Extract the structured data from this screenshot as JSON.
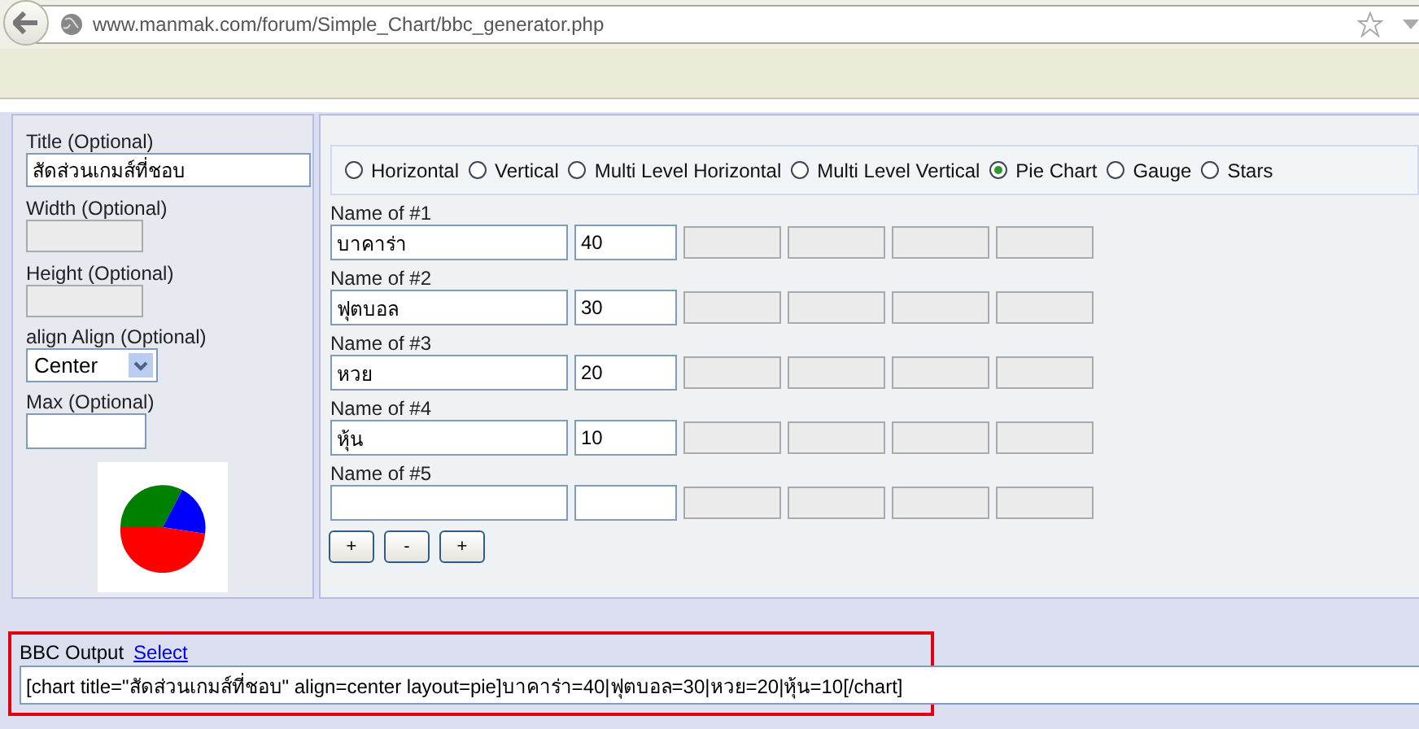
{
  "browser": {
    "url": "www.manmak.com/forum/Simple_Chart/bbc_generator.php",
    "starred": false
  },
  "settings": {
    "title": {
      "label": "Title (Optional)",
      "value": "สัดส่วนเกมส์ที่ชอบ"
    },
    "width": {
      "label": "Width (Optional)",
      "disabled": true
    },
    "height": {
      "label": "Height (Optional)",
      "disabled": true
    },
    "align": {
      "label": "align Align (Optional)",
      "value": "Center"
    },
    "max": {
      "label": "Max (Optional)",
      "disabled": false
    }
  },
  "chart_types": [
    {
      "label": "Horizontal",
      "selected": false
    },
    {
      "label": "Vertical",
      "selected": false
    },
    {
      "label": "Multi Level Horizontal",
      "selected": false
    },
    {
      "label": "Multi Level Vertical",
      "selected": false
    },
    {
      "label": "Pie Chart",
      "selected": true
    },
    {
      "label": "Gauge",
      "selected": false
    },
    {
      "label": "Stars",
      "selected": false
    }
  ],
  "items": [
    {
      "label": "Name of #1",
      "name": "บาคาร่า",
      "value": "40"
    },
    {
      "label": "Name of #2",
      "name": "ฟุตบอล",
      "value": "30"
    },
    {
      "label": "Name of #3",
      "name": "หวย",
      "value": "20"
    },
    {
      "label": "Name of #4",
      "name": "หุ้น",
      "value": "10"
    },
    {
      "label": "Name of #5"
    }
  ],
  "row_buttons": [
    "+",
    "-",
    "+"
  ],
  "output": {
    "label": "BBC Output",
    "link": "Select",
    "value": "[chart title=\"สัดส่วนเกมส์ที่ชอบ\" align=center layout=pie]บาคาร่า=40|ฟุตบอล=30|หวย=20|หุ้น=10[/chart]"
  }
}
